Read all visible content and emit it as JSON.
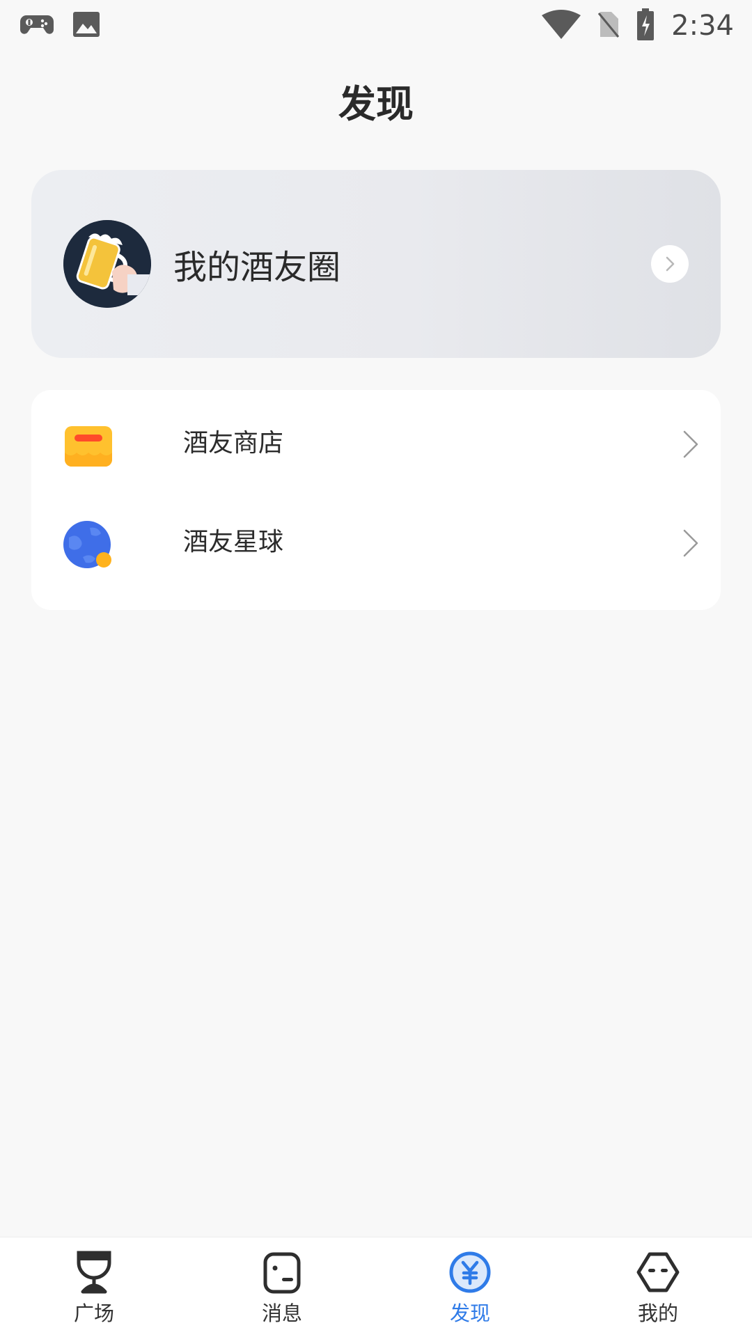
{
  "status_bar": {
    "time": "2:34",
    "icons": [
      "gamepad-icon",
      "image-icon",
      "wifi-icon",
      "no-sim-icon",
      "battery-charging-icon"
    ]
  },
  "header": {
    "title": "发现"
  },
  "moments": {
    "label": "我的酒友圈",
    "avatar_icon": "beer-mug-icon",
    "arrow_icon": "chevron-right-icon"
  },
  "menu": {
    "items": [
      {
        "label": "酒友商店",
        "icon": "shop-icon"
      },
      {
        "label": "酒友星球",
        "icon": "planet-icon"
      }
    ]
  },
  "bottom_nav": {
    "items": [
      {
        "label": "广场",
        "icon": "goblet-icon",
        "active": false
      },
      {
        "label": "消息",
        "icon": "message-icon",
        "active": false
      },
      {
        "label": "发现",
        "icon": "yuan-coin-icon",
        "active": true
      },
      {
        "label": "我的",
        "icon": "hexagon-face-icon",
        "active": false
      }
    ]
  },
  "colors": {
    "accent": "#2f7be8",
    "background": "#f8f8f8",
    "card": "#ffffff"
  }
}
